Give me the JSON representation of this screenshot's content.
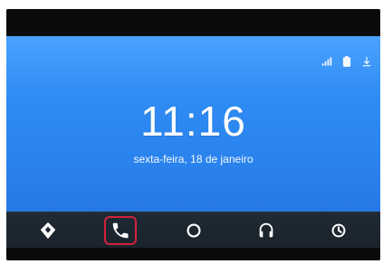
{
  "home": {
    "time": "11:16",
    "date": "sexta-feira, 18 de janeiro"
  },
  "status": {
    "icons": [
      "signal-wifi-icon",
      "battery-icon",
      "download-icon"
    ]
  },
  "navbar": {
    "items": [
      {
        "name": "navigation",
        "icon": "navigation-icon"
      },
      {
        "name": "phone",
        "icon": "phone-icon",
        "highlighted": true
      },
      {
        "name": "home",
        "icon": "home-circle-icon"
      },
      {
        "name": "music",
        "icon": "headphones-icon"
      },
      {
        "name": "recent",
        "icon": "recent-clock-icon"
      }
    ],
    "highlight_color": "#d3223b"
  },
  "colors": {
    "background_blue": "#2f8cf4",
    "nav_dark": "#1f2a34",
    "text": "#ffffff"
  }
}
